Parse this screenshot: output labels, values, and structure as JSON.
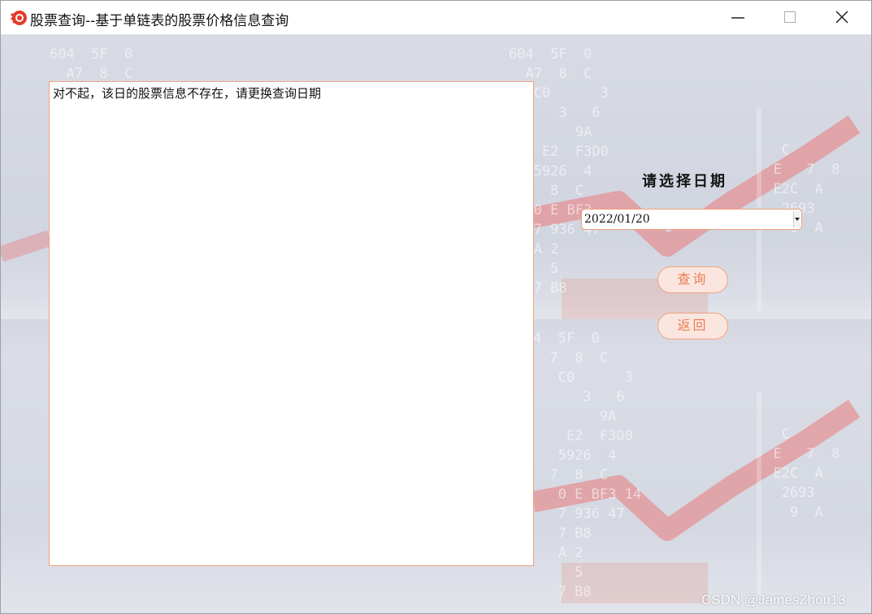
{
  "window": {
    "title": "股票查询--基于单链表的股票价格信息查询",
    "controls": [
      "minimize-icon",
      "maximize-icon",
      "close-icon"
    ]
  },
  "result": {
    "message": "对不起，该日的股票信息不存在，请更换查询日期"
  },
  "date_picker": {
    "label": "请选择日期",
    "selected": "2022/01/20"
  },
  "buttons": {
    "query": "查询",
    "back": "返回"
  },
  "watermark": "CSDN @JamesZhou13",
  "colors": {
    "accent": "#ea7d57",
    "accent_border": "#f2a27e",
    "panel_border": "#f2a27a"
  }
}
